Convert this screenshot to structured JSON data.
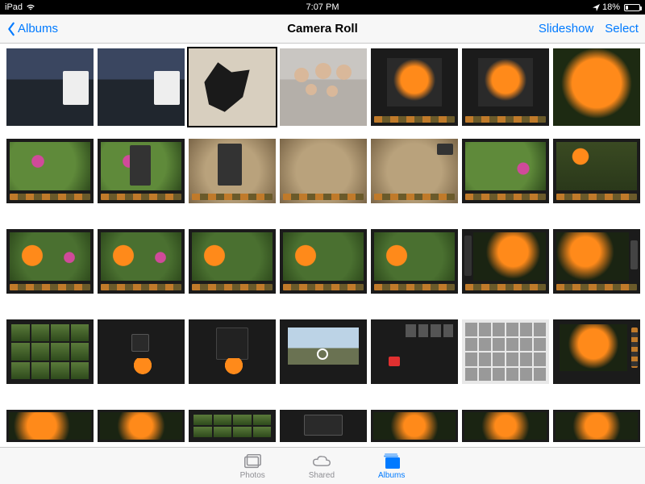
{
  "status": {
    "device": "iPad",
    "time": "7:07 PM",
    "battery_pct": "18%"
  },
  "nav": {
    "back_label": "Albums",
    "title": "Camera Roll",
    "slideshow": "Slideshow",
    "select": "Select"
  },
  "tabs": {
    "photos": "Photos",
    "shared": "Shared",
    "albums": "Albums",
    "active": "albums"
  },
  "grid": {
    "columns": 7,
    "rows_visible": 5
  }
}
